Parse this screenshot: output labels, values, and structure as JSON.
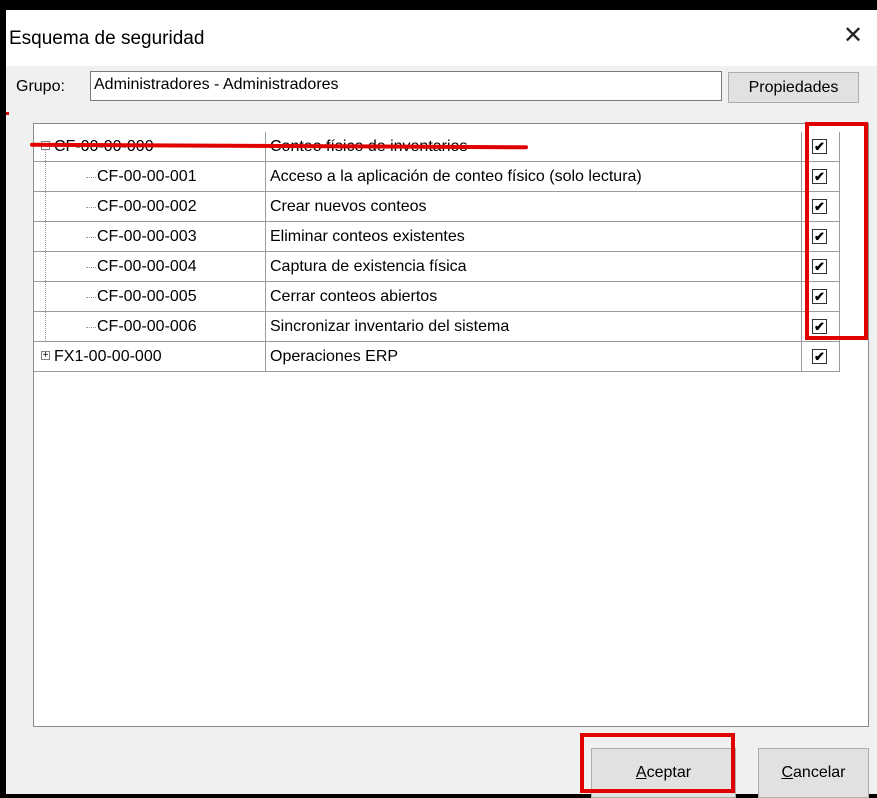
{
  "window": {
    "title": "Esquema de seguridad",
    "close_glyph": "✕"
  },
  "grupo": {
    "label": "Grupo:",
    "value": "Administradores - Administradores"
  },
  "buttons": {
    "propiedades": "Propiedades",
    "aceptar": "Aceptar",
    "aceptar_accel": "A",
    "aceptar_rest": "ceptar",
    "cancelar": "Cancelar",
    "cancelar_accel": "C",
    "cancelar_rest": "ancelar"
  },
  "tree": {
    "rows": [
      {
        "code": "CF-00-00-000",
        "desc": "Conteo físico de inventarios",
        "checked": true,
        "level": 0,
        "expander": "−"
      },
      {
        "code": "CF-00-00-001",
        "desc": "Acceso a la aplicación de conteo físico (solo lectura)",
        "checked": true,
        "level": 1
      },
      {
        "code": "CF-00-00-002",
        "desc": "Crear nuevos conteos",
        "checked": true,
        "level": 1
      },
      {
        "code": "CF-00-00-003",
        "desc": "Eliminar conteos existentes",
        "checked": true,
        "level": 1
      },
      {
        "code": "CF-00-00-004",
        "desc": "Captura de existencia física",
        "checked": true,
        "level": 1
      },
      {
        "code": "CF-00-00-005",
        "desc": "Cerrar conteos abiertos",
        "checked": true,
        "level": 1
      },
      {
        "code": "CF-00-00-006",
        "desc": "Sincronizar inventario del sistema",
        "checked": true,
        "level": 1
      },
      {
        "code": "FX1-00-00-000",
        "desc": "Operaciones ERP",
        "checked": true,
        "level": 0,
        "expander": "+"
      }
    ],
    "check_glyph": "✔"
  },
  "colors": {
    "highlight": "#e00000"
  }
}
